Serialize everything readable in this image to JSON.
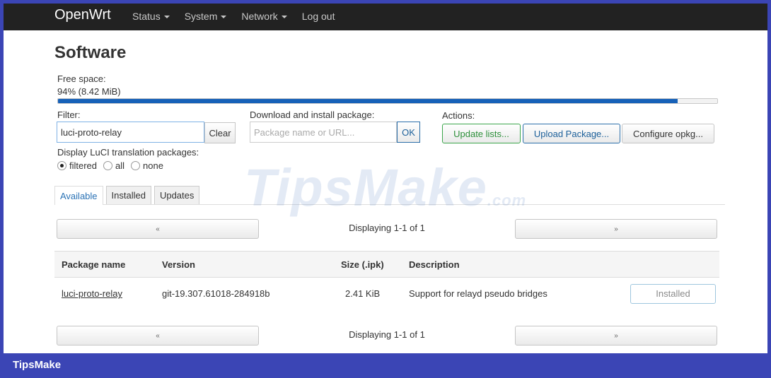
{
  "navbar": {
    "brand": "OpenWrt",
    "menu": [
      {
        "label": "Status",
        "dropdown": true
      },
      {
        "label": "System",
        "dropdown": true
      },
      {
        "label": "Network",
        "dropdown": true
      },
      {
        "label": "Log out",
        "dropdown": false
      }
    ]
  },
  "page": {
    "title": "Software",
    "free_space": {
      "label": "Free space:",
      "value": "94% (8.42 MiB)",
      "fraction": 0.94
    },
    "filter": {
      "label": "Filter:",
      "value": "luci-proto-relay",
      "clear_label": "Clear"
    },
    "download": {
      "label": "Download and install package:",
      "placeholder": "Package name or URL...",
      "ok_label": "OK"
    },
    "actions": {
      "label": "Actions:",
      "update_lists": "Update lists...",
      "upload_package": "Upload Package...",
      "configure_opkg": "Configure opkg..."
    },
    "translation": {
      "label": "Display LuCI translation packages:",
      "options": [
        "filtered",
        "all",
        "none"
      ],
      "selected": "filtered"
    },
    "tabs": [
      {
        "label": "Available",
        "active": true
      },
      {
        "label": "Installed",
        "active": false
      },
      {
        "label": "Updates",
        "active": false
      }
    ],
    "pager": {
      "prev": "«",
      "next": "»",
      "text": "Displaying 1-1 of 1"
    },
    "table": {
      "headers": [
        "Package name",
        "Version",
        "Size (.ipk)",
        "Description"
      ],
      "rows": [
        {
          "name": "luci-proto-relay",
          "version": "git-19.307.61018-284918b",
          "size": "2.41 KiB",
          "description": "Support for relayd pseudo bridges",
          "action": "Installed"
        }
      ]
    }
  },
  "watermark": {
    "main": "TipsMake",
    "suffix": ".com"
  },
  "footer": {
    "logo": "TipsMake"
  },
  "colors": {
    "navbar_bg": "#222222",
    "progress": "#1761b8",
    "frame_border": "#3b45b5",
    "update_btn": "#3aa54a",
    "upload_btn": "#2a6ea9"
  }
}
